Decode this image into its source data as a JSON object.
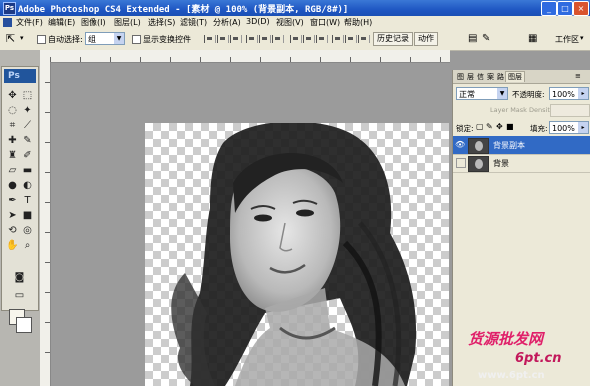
{
  "titlebar": {
    "title": "Adobe Photoshop CS4 Extended - [素材 @ 100% (背景副本, RGB/8#)]",
    "buttons": [
      "_",
      "□",
      "×"
    ]
  },
  "menu": [
    "文件(F)",
    "编辑(E)",
    "图像(I)",
    "图层(L)",
    "选择(S)",
    "滤镜(T)",
    "分析(A)",
    "3D(D)",
    "视图(V)",
    "窗口(W)",
    "帮助(H)"
  ],
  "options": {
    "auto_select_label": "自动选择:",
    "auto_select_value": "组",
    "show_transform_label": "显示变换控件",
    "history_tab": "历史记录",
    "actions_tab": "动作",
    "workspace_label": "工作区"
  },
  "tools": {
    "logo": "Ps"
  },
  "layers_panel": {
    "tabs": [
      "图",
      "层",
      "信",
      "案",
      "路",
      "图层"
    ],
    "blend_mode": "正常",
    "opacity_label": "不透明度:",
    "opacity_value": "100%",
    "mask_density_label": "Layer Mask Density",
    "lock_label": "锁定:",
    "fill_label": "填充:",
    "fill_value": "100%",
    "layers": [
      {
        "name": "背景副本",
        "visible": true,
        "selected": true
      },
      {
        "name": "背景",
        "visible": false,
        "selected": false
      }
    ]
  },
  "watermark": {
    "line1": "货源批发网",
    "line2": "6pt.cn",
    "line3": "www.6pt.cn"
  },
  "colors": {
    "titlebar": "#1f57c3",
    "selected_layer": "#316ac5",
    "watermark": "#e0206a"
  }
}
